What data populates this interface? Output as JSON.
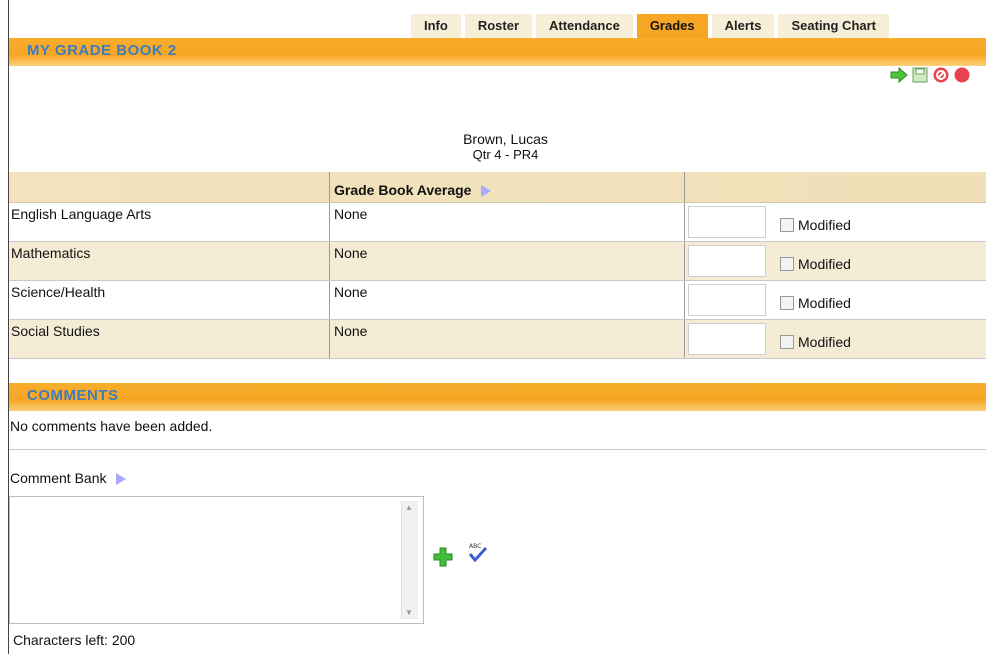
{
  "tabs": [
    "Info",
    "Roster",
    "Attendance",
    "Grades",
    "Alerts",
    "Seating Chart"
  ],
  "active_tab": "Grades",
  "gradebook": {
    "title": "MY GRADE BOOK 2",
    "student_name": "Brown, Lucas",
    "period": "Qtr 4 - PR4",
    "average_header": "Grade Book Average",
    "modified_label": "Modified",
    "rows": [
      {
        "subject": "English Language Arts",
        "average": "None"
      },
      {
        "subject": "Mathematics",
        "average": "None"
      },
      {
        "subject": "Science/Health",
        "average": "None"
      },
      {
        "subject": "Social Studies",
        "average": "None"
      }
    ]
  },
  "comments": {
    "title": "COMMENTS",
    "empty_message": "No comments have been added.",
    "bank_label": "Comment Bank",
    "characters_left": "Characters left: 200"
  },
  "icons": [
    "arrow-right-icon",
    "save-icon",
    "cancel-icon",
    "close-icon",
    "add-icon",
    "spellcheck-icon"
  ]
}
